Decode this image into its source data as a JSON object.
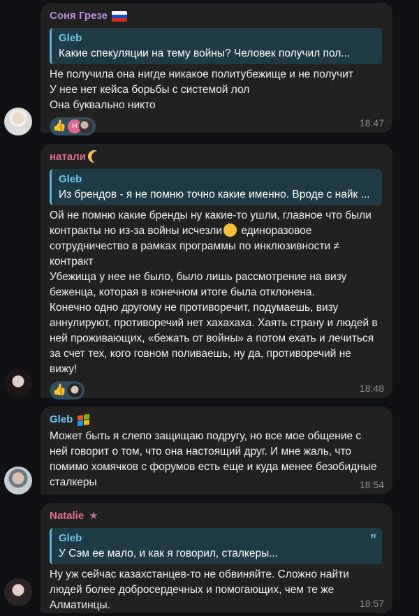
{
  "messages": [
    {
      "sender": "Соня Грезе",
      "sender_color": "#b98ee8",
      "quote": {
        "name": "Gleb",
        "text": "Какие спекуляции на тему войны? Человек получил пол..."
      },
      "lines": [
        "Не получила она нигде никакое политубежище и не получит",
        "У нее нет кейса борьбы с системой лол",
        "Она буквально никто"
      ],
      "reactions": [
        {
          "emoji": "👍",
          "avatars": [
            "Н",
            ""
          ]
        }
      ],
      "time": "18:47"
    },
    {
      "sender": "натали",
      "sender_color": "#e06e8a",
      "quote": {
        "name": "Gleb",
        "text": "Из брендов - я не помню точно какие именно. Вроде с найк ..."
      },
      "lines": [
        "Ой не помню какие бренды ну какие-то ушли, главное что были",
        "контракты но из-за войны исчезли",
        "единоразовое",
        "сотрудничество в рамках программы по инклюзивности ≠",
        "контракт",
        "Убежища у нее не было, было лишь рассмотрение на визу",
        "беженца, которая в конечном итоге была отклонена.",
        "Конечно одно другому не противоречит, подумаешь, визу",
        "аннулируют, противоречий нет хахахаха. Хаять страну и людей в",
        "ней проживающих, «бежать от войны» а потом ехать и лечиться",
        "за счет тех, кого говном поливаешь, ну да, противоречий не",
        "вижу!"
      ],
      "reactions": [
        {
          "emoji": "👍",
          "avatars": [
            ""
          ]
        }
      ],
      "time": "18:48"
    },
    {
      "sender": "Gleb",
      "sender_color": "#6ec6ee",
      "lines": [
        "Может быть я слепо защищаю подругу, но все мое общение с",
        "ней говорит о том, что она настоящий друг. И мне жаль, что",
        "помимо хомячков с форумов есть еще и куда менее безобидные",
        "сталкеры"
      ],
      "time": "18:54"
    },
    {
      "sender": "Natalie",
      "sender_color": "#e06e8a",
      "quote": {
        "name": "Gleb",
        "text": "У Сэм ее мало, и как я говорил, сталкеры..."
      },
      "lines": [
        "Ну уж сейчас казахстанцев-то не обвиняйте. Сложно найти",
        "людей более добросердечных и помогающих, чем те же",
        "Алматинцы."
      ],
      "time": "18:57"
    }
  ]
}
